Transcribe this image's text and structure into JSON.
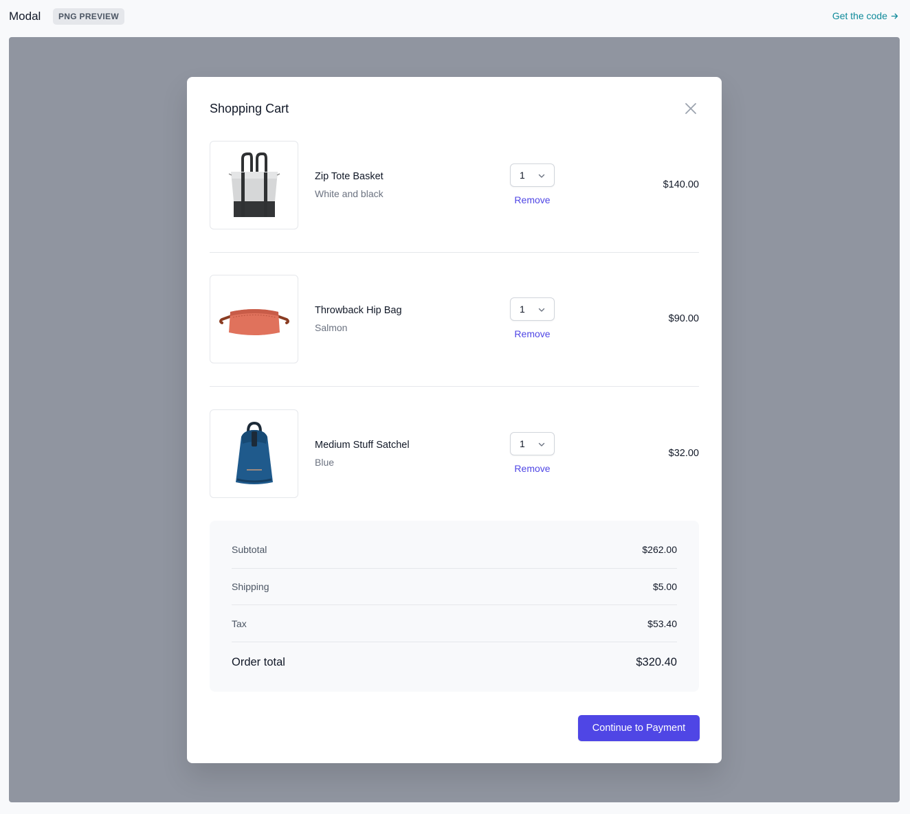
{
  "topbar": {
    "title": "Modal",
    "badge": "PNG PREVIEW",
    "link": "Get the code"
  },
  "modal": {
    "title": "Shopping Cart",
    "items": [
      {
        "name": "Zip Tote Basket",
        "variant": "White and black",
        "quantity": "1",
        "remove_label": "Remove",
        "price": "$140.00",
        "image": "tote-bag-image"
      },
      {
        "name": "Throwback Hip Bag",
        "variant": "Salmon",
        "quantity": "1",
        "remove_label": "Remove",
        "price": "$90.00",
        "image": "hip-bag-image"
      },
      {
        "name": "Medium Stuff Satchel",
        "variant": "Blue",
        "quantity": "1",
        "remove_label": "Remove",
        "price": "$32.00",
        "image": "satchel-backpack-image"
      }
    ],
    "summary": {
      "subtotal_label": "Subtotal",
      "subtotal": "$262.00",
      "shipping_label": "Shipping",
      "shipping": "$5.00",
      "tax_label": "Tax",
      "tax": "$53.40",
      "total_label": "Order total",
      "total": "$320.40"
    },
    "cta_label": "Continue to Payment"
  },
  "colors": {
    "accent": "#4f46e5",
    "link": "#0e8a9a",
    "backdrop": "#9095a0"
  }
}
